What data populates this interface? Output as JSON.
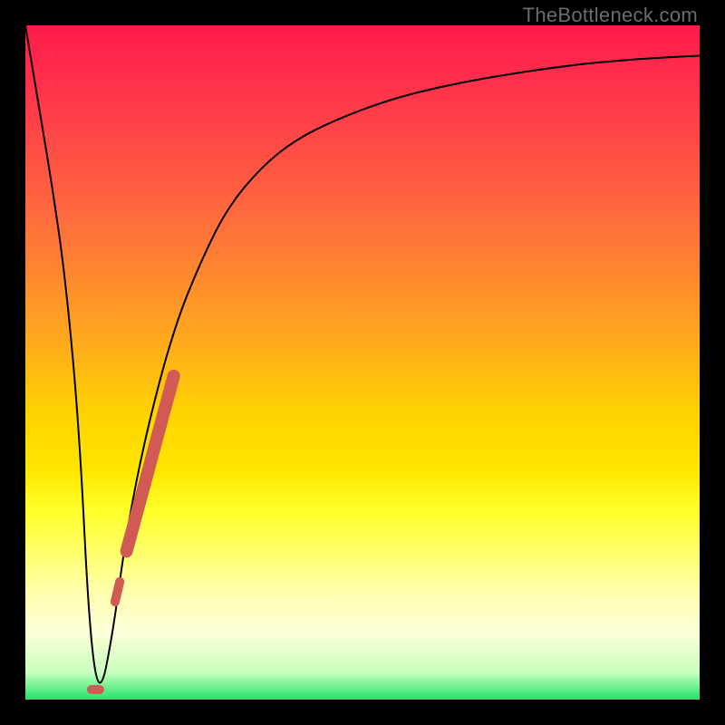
{
  "watermark": {
    "text": "TheBottleneck.com"
  },
  "chart_data": {
    "type": "line",
    "title": "",
    "xlabel": "",
    "ylabel": "",
    "xlim": [
      0,
      100
    ],
    "ylim": [
      0,
      100
    ],
    "grid": false,
    "legend": false,
    "background_gradient": {
      "direction": "vertical",
      "stops": [
        {
          "pos": 0.0,
          "color": "#ff1a4d"
        },
        {
          "pos": 0.45,
          "color": "#ffa321"
        },
        {
          "pos": 0.7,
          "color": "#ffff2a"
        },
        {
          "pos": 0.95,
          "color": "#c8ffbe"
        },
        {
          "pos": 1.0,
          "color": "#22e36a"
        }
      ]
    },
    "series": [
      {
        "name": "bottleneck-curve",
        "color": "#000000",
        "stroke_width": 2,
        "x": [
          0,
          2,
          4,
          6,
          8,
          9.5,
          11,
          13,
          15,
          18,
          22,
          26,
          30,
          35,
          40,
          46,
          54,
          62,
          70,
          80,
          90,
          100
        ],
        "y": [
          100,
          88,
          76,
          62,
          40,
          10,
          0,
          10,
          25,
          40,
          55,
          65,
          73,
          79,
          83,
          86,
          89,
          91,
          92.5,
          94,
          95,
          95.5
        ]
      },
      {
        "name": "highlight-segment",
        "color": "#d25a55",
        "stroke_width": 14,
        "linecap": "round",
        "x": [
          15,
          22
        ],
        "y": [
          22,
          48
        ]
      },
      {
        "name": "highlight-dash-1",
        "color": "#d25a55",
        "stroke_width": 10,
        "linecap": "round",
        "x": [
          13.3,
          14.0
        ],
        "y": [
          14.5,
          17.5
        ]
      },
      {
        "name": "highlight-dot-lowest",
        "color": "#d25a55",
        "stroke_width": 10,
        "linecap": "round",
        "x": [
          9.8,
          11.0
        ],
        "y": [
          1.5,
          1.5
        ]
      }
    ]
  }
}
